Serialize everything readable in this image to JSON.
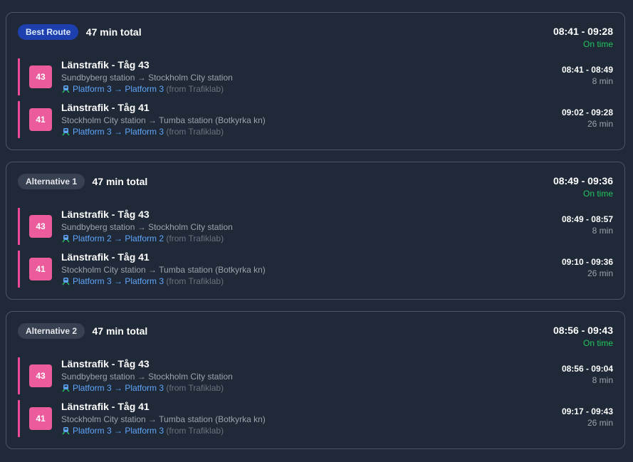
{
  "routes": [
    {
      "badge": "Best Route",
      "total": "47 min total",
      "time_range": "08:41 - 09:28",
      "status": "On time",
      "legs": [
        {
          "line": "43",
          "title": "Länstrafik - Tåg 43",
          "stations": "Sundbyberg station → Stockholm City station",
          "platform_text": "Platform 3 → Platform 3",
          "source": "(from Trafiklab)",
          "time_range": "08:41 - 08:49",
          "duration": "8 min"
        },
        {
          "line": "41",
          "title": "Länstrafik - Tåg 41",
          "stations": "Stockholm City station → Tumba station (Botkyrka kn)",
          "platform_text": "Platform 3 → Platform 3",
          "source": "(from Trafiklab)",
          "time_range": "09:02 - 09:28",
          "duration": "26 min"
        }
      ]
    },
    {
      "badge": "Alternative 1",
      "total": "47 min total",
      "time_range": "08:49 - 09:36",
      "status": "On time",
      "legs": [
        {
          "line": "43",
          "title": "Länstrafik - Tåg 43",
          "stations": "Sundbyberg station → Stockholm City station",
          "platform_text": "Platform 2 → Platform 2",
          "source": "(from Trafiklab)",
          "time_range": "08:49 - 08:57",
          "duration": "8 min"
        },
        {
          "line": "41",
          "title": "Länstrafik - Tåg 41",
          "stations": "Stockholm City station → Tumba station (Botkyrka kn)",
          "platform_text": "Platform 3 → Platform 3",
          "source": "(from Trafiklab)",
          "time_range": "09:10 - 09:36",
          "duration": "26 min"
        }
      ]
    },
    {
      "badge": "Alternative 2",
      "total": "47 min total",
      "time_range": "08:56 - 09:43",
      "status": "On time",
      "legs": [
        {
          "line": "43",
          "title": "Länstrafik - Tåg 43",
          "stations": "Sundbyberg station → Stockholm City station",
          "platform_text": "Platform 3 → Platform 3",
          "source": "(from Trafiklab)",
          "time_range": "08:56 - 09:04",
          "duration": "8 min"
        },
        {
          "line": "41",
          "title": "Länstrafik - Tåg 41",
          "stations": "Stockholm City station → Tumba station (Botkyrka kn)",
          "platform_text": "Platform 3 → Platform 3",
          "source": "(from Trafiklab)",
          "time_range": "09:17 - 09:43",
          "duration": "26 min"
        }
      ]
    }
  ],
  "colors": {
    "background": "#1f2937",
    "card_border": "#4b5563",
    "best_badge": "#1e40af",
    "alt_badge": "#374151",
    "line_accent": "#ec4899",
    "on_time": "#22c55e",
    "platform_link": "#60a5fa"
  },
  "icons": {
    "platform": "train-platform-icon"
  }
}
